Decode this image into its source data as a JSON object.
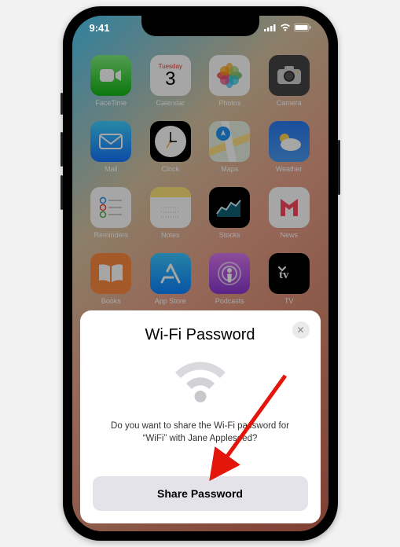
{
  "status": {
    "time": "9:41"
  },
  "calendar": {
    "dow": "Tuesday",
    "day": "3"
  },
  "apps": {
    "facetime": "FaceTime",
    "calendar": "Calendar",
    "photos": "Photos",
    "camera": "Camera",
    "mail": "Mail",
    "clock": "Clock",
    "maps": "Maps",
    "weather": "Weather",
    "reminders": "Reminders",
    "notes": "Notes",
    "stocks": "Stocks",
    "news": "News",
    "books": "Books",
    "appstore": "App Store",
    "podcasts": "Podcasts",
    "tv": "TV"
  },
  "sheet": {
    "title": "Wi-Fi Password",
    "message": "Do you want to share the Wi-Fi password for “WiFi” with Jane Appleseed?",
    "share_button": "Share Password"
  }
}
